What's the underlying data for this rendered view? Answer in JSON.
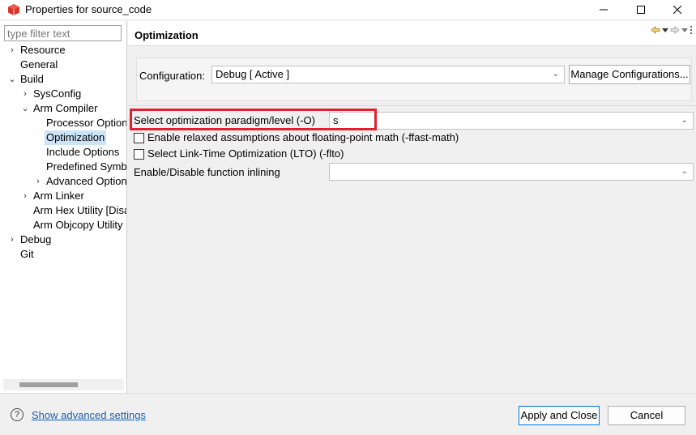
{
  "window": {
    "title": "Properties for source_code",
    "icon": "cube-icon",
    "controls": [
      "minimize-icon",
      "maximize-icon",
      "close-icon"
    ]
  },
  "filter": {
    "placeholder": "type filter text"
  },
  "tree": {
    "items": [
      {
        "label": "Resource",
        "arrow": "›",
        "level": 0
      },
      {
        "label": "General",
        "arrow": "",
        "level": 0
      },
      {
        "label": "Build",
        "arrow": "⌄",
        "level": 0
      },
      {
        "label": "SysConfig",
        "arrow": "›",
        "level": 1
      },
      {
        "label": "Arm Compiler",
        "arrow": "⌄",
        "level": 1
      },
      {
        "label": "Processor Options",
        "arrow": "",
        "level": 2
      },
      {
        "label": "Optimization",
        "arrow": "",
        "level": 2,
        "selected": true
      },
      {
        "label": "Include Options",
        "arrow": "",
        "level": 2
      },
      {
        "label": "Predefined Symbols",
        "arrow": "",
        "level": 2
      },
      {
        "label": "Advanced Options",
        "arrow": "›",
        "level": 2
      },
      {
        "label": "Arm Linker",
        "arrow": "›",
        "level": 1
      },
      {
        "label": "Arm Hex Utility  [Disabled]",
        "arrow": "",
        "level": 1
      },
      {
        "label": "Arm Objcopy Utility",
        "arrow": "",
        "level": 1
      },
      {
        "label": "Debug",
        "arrow": "›",
        "level": 0
      },
      {
        "label": "Git",
        "arrow": "",
        "level": 0
      }
    ]
  },
  "page": {
    "title": "Optimization",
    "nav_icons": [
      "back-arrow-icon",
      "dropdown-icon",
      "forward-arrow-icon",
      "dropdown-icon",
      "menu-icon"
    ]
  },
  "configuration": {
    "label": "Configuration:",
    "value": "Debug  [ Active ]",
    "manage_button": "Manage Configurations..."
  },
  "optimization": {
    "level_label": "Select optimization paradigm/level (-O)",
    "level_value": "s",
    "fast_math_label": "Enable relaxed assumptions about floating-point math (-ffast-math)",
    "fast_math_checked": false,
    "lto_label": "Select Link-Time Optimization (LTO) (-flto)",
    "lto_checked": false,
    "inlining_label": "Enable/Disable function inlining",
    "inlining_value": ""
  },
  "footer": {
    "advanced_link": "Show advanced settings",
    "apply_button": "Apply and Close",
    "cancel_button": "Cancel"
  },
  "colors": {
    "highlight": "#e0202e",
    "selection": "#cce4f7",
    "link": "#1a5fb4"
  }
}
